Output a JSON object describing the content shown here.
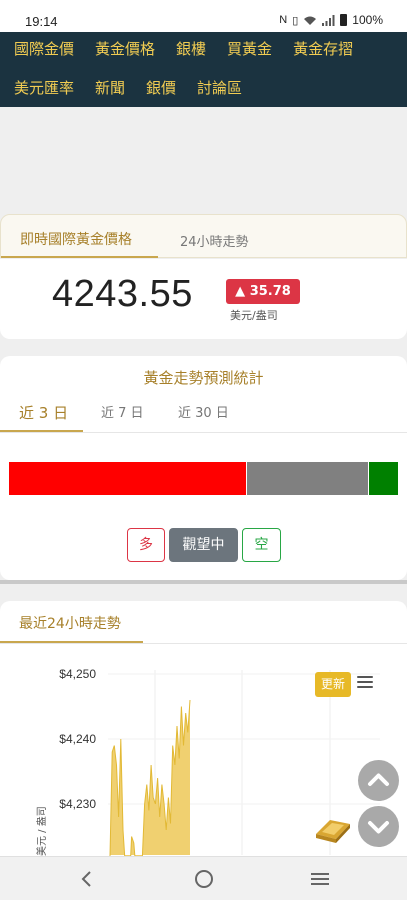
{
  "status_bar": {
    "time": "19:14",
    "battery": "100%",
    "icons": [
      "nfc-icon",
      "vibrate-icon",
      "wifi-icon",
      "signal-icon",
      "battery-icon"
    ]
  },
  "nav": {
    "row1": [
      "國際金價",
      "黃金價格",
      "銀樓",
      "買黃金",
      "黃金存摺"
    ],
    "row2": [
      "美元匯率",
      "新聞",
      "銀價",
      "討論區"
    ]
  },
  "price_tabs": {
    "active": "即時國際黃金價格",
    "inactive": "24小時走勢"
  },
  "price": {
    "value": "4243.55",
    "change": "35.78",
    "change_arrow": "▲",
    "unit": "美元/盎司"
  },
  "forecast": {
    "title": "黃金走勢預測統計",
    "tabs": [
      "近 3 日",
      "近 7 日",
      "近 30 日"
    ],
    "active_tab": "近 3 日",
    "shares": {
      "bull": 0.61,
      "neutral": 0.31,
      "bear": 0.08
    },
    "buttons": {
      "bull": "多",
      "watch": "觀望中",
      "bear": "空"
    }
  },
  "trend": {
    "title": "最近24小時走勢",
    "refresh_label": "更新"
  },
  "chart_data": {
    "type": "area",
    "ylabel": "美元 / 盎司",
    "yticks": [
      "$4,250",
      "$4,240",
      "$4,230"
    ],
    "ytick_values": [
      4250,
      4240,
      4230
    ],
    "ylim": [
      4220,
      4255
    ],
    "grid": true,
    "series": [
      {
        "values": [
          4222,
          4238,
          4239,
          4236,
          4228,
          4240,
          4226,
          4221,
          4219,
          4218,
          4225,
          4224,
          4220,
          4219,
          4217,
          4222,
          4230,
          4233,
          4229,
          4236,
          4231,
          4230,
          4234,
          4228,
          4233,
          4230,
          4226,
          4231,
          4227,
          4239,
          4236,
          4242,
          4237,
          4245,
          4239,
          4244,
          4241,
          4246
        ]
      }
    ],
    "colors": {
      "fill": "#f0d070",
      "line": "#e2b935"
    }
  },
  "colors": {
    "nav_bg": "#1b3340",
    "nav_text": "#f1cc52",
    "accent_gold": "#a7802a",
    "bull_red": "#ff0000",
    "neutral_gray": "#808080",
    "bear_green": "#008000"
  }
}
